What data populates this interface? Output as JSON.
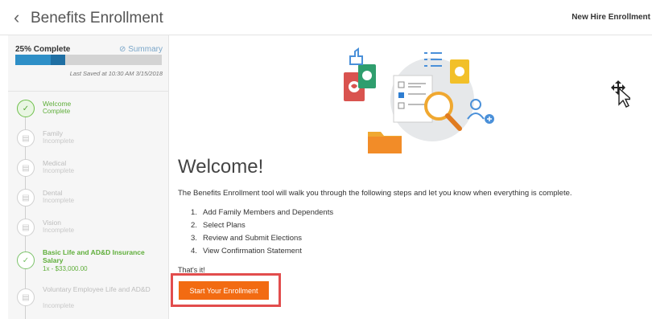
{
  "header": {
    "back_icon": "chevron-left-icon",
    "title": "Benefits Enrollment",
    "right_label": "New Hire Enrollment"
  },
  "progress": {
    "percent_label": "25% Complete",
    "percent_value": 0.34,
    "summary_link": "Summary",
    "summary_icon": "link-icon",
    "last_saved": "Last Saved at 10:30 AM 3/15/2018"
  },
  "steps": [
    {
      "name": "Welcome",
      "status": "Complete",
      "state": "done",
      "icon": "check-document-icon"
    },
    {
      "name": "Family",
      "status": "Incomplete",
      "state": "todo",
      "icon": "document-icon"
    },
    {
      "name": "Medical",
      "status": "Incomplete",
      "state": "todo",
      "icon": "document-icon"
    },
    {
      "name": "Dental",
      "status": "Incomplete",
      "state": "todo",
      "icon": "document-icon"
    },
    {
      "name": "Vision",
      "status": "Incomplete",
      "state": "todo",
      "icon": "document-icon"
    },
    {
      "name": "Basic Life and AD&D Insurance Salary",
      "status": "1x - $33,000.00",
      "state": "active",
      "icon": "check-circle-icon"
    },
    {
      "name": "Voluntary Employee Life and AD&D",
      "status": "Incomplete",
      "state": "todo",
      "icon": "document-icon"
    }
  ],
  "main": {
    "title": "Welcome!",
    "intro": "The Benefits Enrollment tool will walk you through the following steps and let you know when everything is complete.",
    "list": [
      {
        "num": "1.",
        "text": "Add Family Members and Dependents"
      },
      {
        "num": "2.",
        "text": "Select Plans"
      },
      {
        "num": "3.",
        "text": "Review and Submit Elections"
      },
      {
        "num": "4.",
        "text": "View Confirmation Statement"
      }
    ],
    "outro": "That's it!",
    "cta_label": "Start Your Enrollment"
  },
  "colors": {
    "accent_orange": "#f26b12",
    "progress_blue": "#2e8fc7",
    "complete_green": "#5fae3a",
    "highlight_red": "#e24d4d"
  }
}
